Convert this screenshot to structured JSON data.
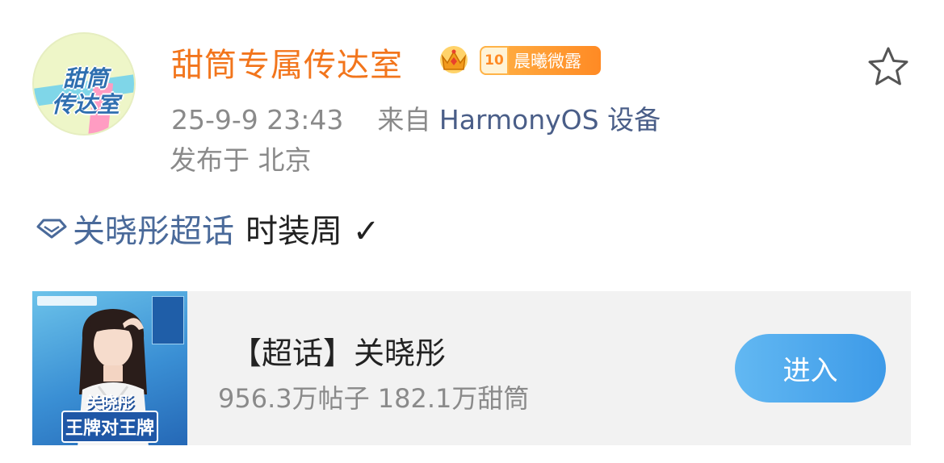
{
  "post": {
    "author": {
      "name": "甜筒专属传达室",
      "avatar_text_line1": "甜筒",
      "avatar_text_line2": "传达室",
      "level_number": "10",
      "level_title": "晨曦微露",
      "crown_icon": "crown-icon",
      "level_icon": "level-badge-icon"
    },
    "timestamp": "25-9-9 23:43",
    "source_prefix": "来自",
    "source_name": "HarmonyOS 设备",
    "location": "发布于 北京",
    "favorite_icon": "star-outline-icon",
    "content": {
      "topic_icon": "diamond-topic-icon",
      "topic_link": "关晓彤超话",
      "text": "时装周 ✓"
    },
    "card": {
      "title": "【超话】关晓彤",
      "stats": "956.3万帖子 182.1万甜筒",
      "thumbnail_caption_line1": "关晓彤",
      "thumbnail_caption_line2": "王牌对王牌",
      "button_label": "进入"
    }
  },
  "colors": {
    "username": "#f2751c",
    "link": "#4a6a9a",
    "meta": "#8a8a8a",
    "button": "#4aa6ee",
    "card_bg": "#f2f2f2"
  }
}
